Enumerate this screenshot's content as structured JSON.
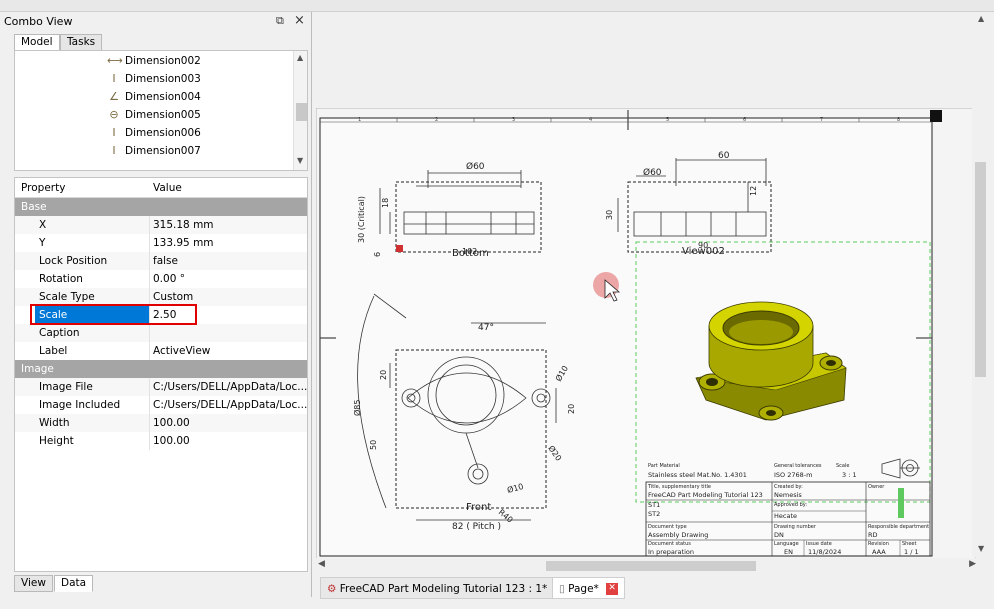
{
  "combo": {
    "title": "Combo View",
    "tabs": [
      "Model",
      "Tasks"
    ],
    "bottom_tabs": [
      "View",
      "Data"
    ]
  },
  "tree": {
    "items": [
      {
        "label": "Dimension002",
        "icon": "horizontal-dimension-icon"
      },
      {
        "label": "Dimension003",
        "icon": "vertical-dimension-icon"
      },
      {
        "label": "Dimension004",
        "icon": "angle-dimension-icon"
      },
      {
        "label": "Dimension005",
        "icon": "diameter-dimension-icon"
      },
      {
        "label": "Dimension006",
        "icon": "vertical-dimension-icon"
      },
      {
        "label": "Dimension007",
        "icon": "vertical-dimension-icon"
      }
    ]
  },
  "properties": {
    "header_property": "Property",
    "header_value": "Value",
    "groups": [
      {
        "name": "Base",
        "rows": [
          {
            "name": "X",
            "value": "315.18 mm"
          },
          {
            "name": "Y",
            "value": "133.95 mm"
          },
          {
            "name": "Lock Position",
            "value": "false"
          },
          {
            "name": "Rotation",
            "value": "0.00 °"
          },
          {
            "name": "Scale Type",
            "value": "Custom"
          },
          {
            "name": "Scale",
            "value": "2.50"
          },
          {
            "name": "Caption",
            "value": ""
          },
          {
            "name": "Label",
            "value": "ActiveView"
          }
        ]
      },
      {
        "name": "Image",
        "rows": [
          {
            "name": "Image File",
            "value": "C:/Users/DELL/AppData/Loc..."
          },
          {
            "name": "Image Included",
            "value": "C:/Users/DELL/AppData/Loc..."
          },
          {
            "name": "Width",
            "value": "100.00"
          },
          {
            "name": "Height",
            "value": "100.00"
          }
        ]
      }
    ]
  },
  "drawing": {
    "views": {
      "bottom": "Bottom",
      "view002": "View002",
      "front": "Front"
    },
    "dims": {
      "d60_bottom": "Ø60",
      "d60_view": "Ø60",
      "len60": "60",
      "h12": "12",
      "h30": "30",
      "h18": "18",
      "critical": "30 (Critical)",
      "h6": "6",
      "d102": "102",
      "d90": "90",
      "ang47": "47°",
      "r20a": "20",
      "r20b": "20",
      "d85": "Ø85",
      "h50": "50",
      "r10a": "Ø10",
      "r10b": "Ø10",
      "r40": "R40",
      "r20c": "Ø20",
      "pitch": "82 ( Pitch )"
    },
    "titleblock": {
      "part_material_label": "Part Material",
      "part_material": "Stainless steel Mat.No. 1.4301",
      "tolerances_label": "General tolerances",
      "tolerances": "ISO 2768-m",
      "scale_label": "Scale",
      "scale": "3 : 1",
      "title_label": "Title, supplementary title",
      "title": "FreeCAD Part Modeling Tutorial 123",
      "st1": "ST1",
      "st2": "ST2",
      "created_label": "Created by:",
      "created": "Nemesis",
      "approved_label": "Approved by:",
      "approved": "Hecate",
      "owner_label": "Owner",
      "doctype_label": "Document type",
      "doctype": "Assembly Drawing",
      "drawnum_label": "Drawing number",
      "drawnum": "DN",
      "dept_label": "Responsible department",
      "dept": "RD",
      "status_label": "Document status",
      "status": "In preparation",
      "lang_label": "Language",
      "lang": "EN",
      "issue_label": "Issue date",
      "issue": "11/8/2024",
      "rev_label": "Revision",
      "rev": "AAA",
      "sheet_label": "Sheet",
      "sheet": "1 / 1"
    },
    "ruler_numbers": [
      "1",
      "2",
      "3",
      "4",
      "5",
      "6",
      "7",
      "8"
    ]
  },
  "doc_tabs": [
    {
      "label": "FreeCAD Part Modeling Tutorial 123 : 1*"
    },
    {
      "label": "Page*"
    }
  ],
  "colors": {
    "selection": "#0078d7",
    "highlight_box": "#e00000",
    "part_yellow": "#c8c800",
    "frame_green": "#5ec95e",
    "close_red": "#e04040"
  }
}
